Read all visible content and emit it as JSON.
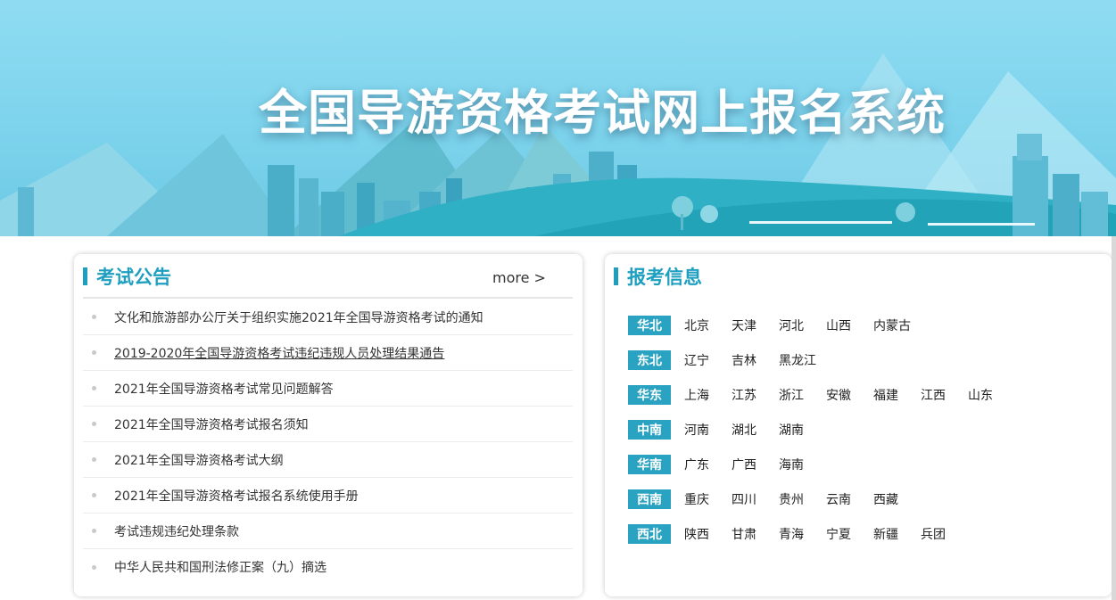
{
  "banner": {
    "title": "全国导游资格考试网上报名系统"
  },
  "announcements": {
    "title": "考试公告",
    "more_label": "more >",
    "items": [
      {
        "text": "文化和旅游部办公厅关于组织实施2021年全国导游资格考试的通知"
      },
      {
        "text": "2019-2020年全国导游资格考试违纪违规人员处理结果通告"
      },
      {
        "text": "2021年全国导游资格考试常见问题解答"
      },
      {
        "text": "2021年全国导游资格考试报名须知"
      },
      {
        "text": "2021年全国导游资格考试大纲"
      },
      {
        "text": "2021年全国导游资格考试报名系统使用手册"
      },
      {
        "text": "考试违规违纪处理条款"
      },
      {
        "text": "中华人民共和国刑法修正案（九）摘选"
      }
    ]
  },
  "registration": {
    "title": "报考信息",
    "regions": [
      {
        "label": "华北",
        "provinces": [
          "北京",
          "天津",
          "河北",
          "山西",
          "内蒙古"
        ]
      },
      {
        "label": "东北",
        "provinces": [
          "辽宁",
          "吉林",
          "黑龙江"
        ]
      },
      {
        "label": "华东",
        "provinces": [
          "上海",
          "江苏",
          "浙江",
          "安徽",
          "福建",
          "江西",
          "山东"
        ]
      },
      {
        "label": "中南",
        "provinces": [
          "河南",
          "湖北",
          "湖南"
        ]
      },
      {
        "label": "华南",
        "provinces": [
          "广东",
          "广西",
          "海南"
        ]
      },
      {
        "label": "西南",
        "provinces": [
          "重庆",
          "四川",
          "贵州",
          "云南",
          "西藏"
        ]
      },
      {
        "label": "西北",
        "provinces": [
          "陕西",
          "甘肃",
          "青海",
          "宁夏",
          "新疆",
          "兵团"
        ]
      }
    ]
  },
  "colors": {
    "accent": "#1f9fc0",
    "region_label_bg": "#2aa3c2"
  }
}
